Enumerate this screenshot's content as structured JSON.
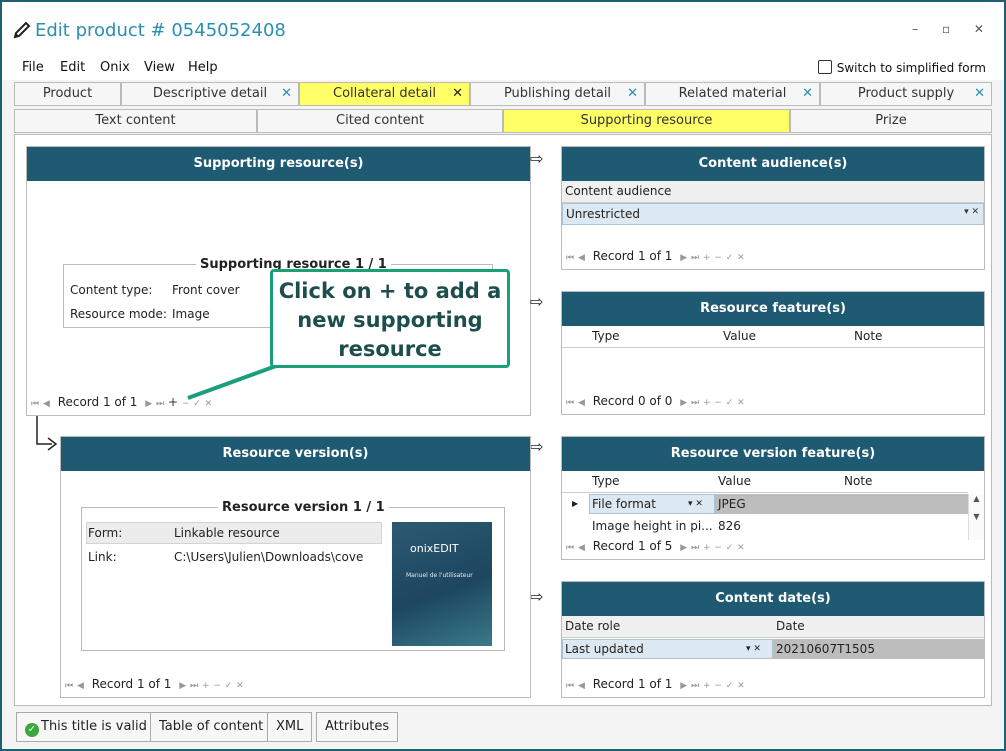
{
  "window": {
    "title": "Edit product # 0545052408",
    "controls": "– ▫ ✕"
  },
  "menu": {
    "items": [
      "File",
      "Edit",
      "Onix",
      "View",
      "Help"
    ],
    "switch_label": "Switch to simplified form"
  },
  "tabs": [
    {
      "label": "Product",
      "closable": false,
      "active": false
    },
    {
      "label": "Descriptive detail",
      "closable": true,
      "active": false
    },
    {
      "label": "Collateral detail",
      "closable": true,
      "active": true
    },
    {
      "label": "Publishing detail",
      "closable": true,
      "active": false
    },
    {
      "label": "Related material",
      "closable": true,
      "active": false
    },
    {
      "label": "Product supply",
      "closable": true,
      "active": false
    }
  ],
  "subtabs": [
    {
      "label": "Text content",
      "active": false
    },
    {
      "label": "Cited content",
      "active": false
    },
    {
      "label": "Supporting resource",
      "active": true
    },
    {
      "label": "Prize",
      "active": false
    }
  ],
  "supporting": {
    "header": "Supporting resource(s)",
    "legend": "Supporting resource 1 / 1",
    "content_type_label": "Content type:",
    "content_type_value": "Front cover",
    "mode_label": "Resource mode:",
    "mode_value": "Image",
    "nav": "Record 1 of 1"
  },
  "callout": "Click on + to add a new supporting resource",
  "version": {
    "header": "Resource version(s)",
    "legend": "Resource version 1 / 1",
    "form_label": "Form:",
    "form_value": "Linkable resource",
    "link_label": "Link:",
    "link_value": "C:\\Users\\Julien\\Downloads\\cover",
    "nav": "Record 1 of 1",
    "thumb_brand": "onixEDIT",
    "thumb_caption": "Manuel de l'utilisateur"
  },
  "audience": {
    "header": "Content audience(s)",
    "column": "Content audience",
    "value": "Unrestricted",
    "nav": "Record 1 of 1"
  },
  "feature": {
    "header": "Resource feature(s)",
    "cols": [
      "Type",
      "Value",
      "Note"
    ],
    "nav": "Record 0 of 0"
  },
  "vfeature": {
    "header": "Resource version feature(s)",
    "cols": [
      "Type",
      "Value",
      "Note"
    ],
    "rows": [
      {
        "type": "File format",
        "value": "JPEG"
      },
      {
        "type": "Image height in pi...",
        "value": "826"
      }
    ],
    "nav": "Record 1 of 5"
  },
  "dates": {
    "header": "Content date(s)",
    "col_role": "Date role",
    "col_date": "Date",
    "role": "Last updated",
    "date": "20210607T1505",
    "nav": "Record 1 of 1"
  },
  "bottom": {
    "valid": "This title is valid",
    "toc": "Table of content",
    "xml": "XML",
    "attributes": "Attributes"
  },
  "colors": {
    "header": "#1f5a73",
    "active_tab": "#ffff66",
    "title": "#2a8fb0",
    "callout_border": "#18a07a"
  }
}
